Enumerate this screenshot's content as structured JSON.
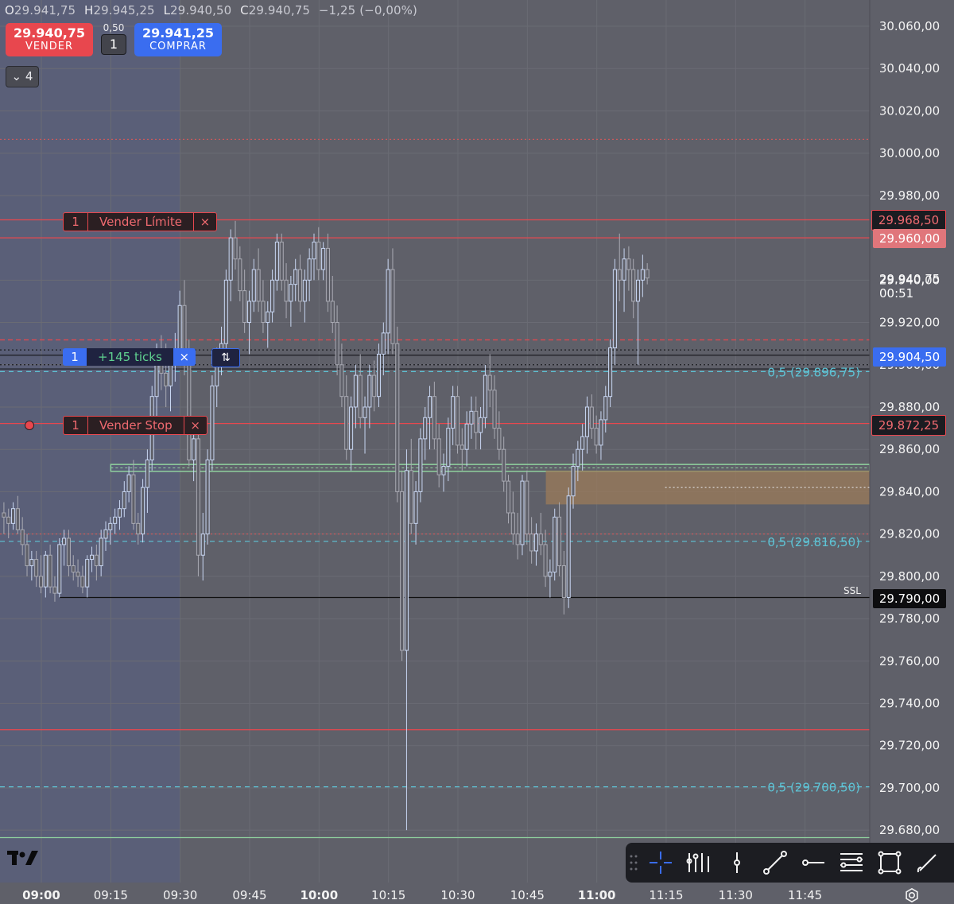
{
  "header": {
    "ohlc": [
      {
        "key": "O",
        "value": "29.941,75"
      },
      {
        "key": "H",
        "value": "29.945,25"
      },
      {
        "key": "L",
        "value": "29.940,50"
      },
      {
        "key": "C",
        "value": "29.940,75"
      }
    ],
    "change": "−1,25 (−0,00%)"
  },
  "trade_panel": {
    "sell_price": "29.940,75",
    "sell_label": "VENDER",
    "spread": "0,50",
    "quantity": "1",
    "buy_price": "29.941,25",
    "buy_label": "COMPRAR"
  },
  "collapse": {
    "label": "4"
  },
  "orders": {
    "limit": {
      "qty": "1",
      "label": "Vender Límite",
      "close": "×"
    },
    "stop": {
      "qty": "1",
      "label": "Vender Stop",
      "close": "×"
    },
    "position": {
      "qty": "1",
      "label": "+145 ticks",
      "close": "×",
      "reverse": "⇅"
    }
  },
  "annotations": {
    "ssl": "SSL",
    "fib_a": "0,5 (29.896,75)",
    "fib_b": "0,5 (29.816,50)",
    "fib_c": "0,5 (29.700,50)"
  },
  "axis_tags": {
    "limit": "29.968,50",
    "alert": "29.960,00",
    "current": "29.940,75",
    "countdown": "00:51",
    "position": "29.904,50",
    "stop": "29.872,25",
    "ssl": "29.790,00"
  },
  "colors": {
    "background": "#5f6069",
    "premarket": "#5a5f79",
    "candle_up": "#c8d6f2",
    "candle_down": "#a9aab3",
    "sell": "#e8474e",
    "buy": "#3a6df0",
    "fib": "#5ec4d6",
    "zone_green": "#8fd19e",
    "zone_brown": "#9b7b5a"
  },
  "toolbar": {
    "icons": [
      "crosshair-icon",
      "fib-tools-icon",
      "vertical-line-icon",
      "trend-line-icon",
      "horizontal-ray-icon",
      "fib-retracement-icon",
      "rectangle-icon",
      "brush-icon"
    ]
  },
  "chart_data": {
    "type": "candlestick",
    "title": "",
    "xlabel": "",
    "ylabel": "",
    "y_ticks": [
      "30.060,00",
      "30.040,00",
      "30.020,00",
      "30.000,00",
      "29.980,00",
      "29.960,00",
      "29.940,00",
      "29.920,00",
      "29.900,00",
      "29.880,00",
      "29.860,00",
      "29.840,00",
      "29.820,00",
      "29.800,00",
      "29.780,00",
      "29.760,00",
      "29.740,00",
      "29.720,00",
      "29.700,00",
      "29.680,00"
    ],
    "y_tick_values": [
      30060,
      30040,
      30020,
      30000,
      29980,
      29960,
      29940,
      29920,
      29900,
      29880,
      29860,
      29840,
      29820,
      29800,
      29780,
      29760,
      29740,
      29720,
      29700,
      29680
    ],
    "x_ticks": [
      "09:00",
      "09:15",
      "09:30",
      "09:45",
      "10:00",
      "10:15",
      "10:30",
      "10:45",
      "11:00",
      "11:15",
      "11:30",
      "11:45"
    ],
    "x_bold_ticks": [
      "09:00",
      "10:00",
      "11:00"
    ],
    "ylim": [
      29670,
      30068
    ],
    "bar_minutes": 1,
    "session_start": "09:00",
    "premarket_end": "09:30",
    "levels": [
      {
        "name": "sell-limit-line",
        "price": 29968.5,
        "color": "#e8474e",
        "style": "solid"
      },
      {
        "name": "alert-line",
        "price": 29960.0,
        "color": "#e8474e",
        "style": "solid"
      },
      {
        "name": "dotted-red-upper",
        "price": 30006.5,
        "color": "#c9595c",
        "style": "dotted"
      },
      {
        "name": "position-line",
        "price": 29904.5,
        "color": "#1b1c21",
        "style": "solid"
      },
      {
        "name": "dashed-red-position",
        "price": 29911.75,
        "color": "#e8474e",
        "style": "dashed"
      },
      {
        "name": "dotted-black-a",
        "price": 29907.0,
        "color": "#1b1c21",
        "style": "dotted"
      },
      {
        "name": "dotted-black-b",
        "price": 29900.0,
        "color": "#1b1c21",
        "style": "dotted"
      },
      {
        "name": "black-line-lower",
        "price": 29898.0,
        "color": "#1b1c21",
        "style": "solid"
      },
      {
        "name": "sell-stop-line",
        "price": 29872.25,
        "color": "#e8474e",
        "style": "solid"
      },
      {
        "name": "dotted-red-lower",
        "price": 29820.0,
        "color": "#c9595c",
        "style": "dotted"
      },
      {
        "name": "red-line-low",
        "price": 29727.5,
        "color": "#e8474e",
        "style": "solid"
      },
      {
        "name": "ssl-line",
        "price": 29790.0,
        "color": "#111111",
        "style": "solid"
      },
      {
        "name": "green-line-bottom",
        "price": 29676.5,
        "color": "#8fd19e",
        "style": "solid"
      }
    ],
    "fib_levels": [
      {
        "price": 29896.75,
        "label_key": "fib_a"
      },
      {
        "price": 29816.5,
        "label_key": "fib_b"
      },
      {
        "price": 29700.5,
        "label_key": "fib_c"
      }
    ],
    "zones": [
      {
        "name": "green-zone",
        "from_time": "09:15",
        "to_time": "end",
        "low": 29850.0,
        "high": 29852.5,
        "color": "#8fd19e"
      },
      {
        "name": "brown-zone",
        "from_time": "10:49",
        "to_time": "end",
        "low": 29834.0,
        "high": 29850.0,
        "color": "#9b7b5a"
      }
    ],
    "candles": [
      [
        29830,
        29835,
        29820,
        29828
      ],
      [
        29828,
        29832,
        29818,
        29825
      ],
      [
        29825,
        29835,
        29822,
        29832
      ],
      [
        29832,
        29838,
        29820,
        29822
      ],
      [
        29822,
        29828,
        29810,
        29815
      ],
      [
        29815,
        29820,
        29800,
        29805
      ],
      [
        29805,
        29812,
        29798,
        29808
      ],
      [
        29808,
        29812,
        29795,
        29800
      ],
      [
        29800,
        29810,
        29792,
        29795
      ],
      [
        29795,
        29812,
        29790,
        29810
      ],
      [
        29810,
        29815,
        29792,
        29795
      ],
      [
        29795,
        29800,
        29788,
        29792
      ],
      [
        29792,
        29818,
        29790,
        29815
      ],
      [
        29815,
        29822,
        29805,
        29818
      ],
      [
        29818,
        29822,
        29800,
        29805
      ],
      [
        29805,
        29810,
        29798,
        29802
      ],
      [
        29802,
        29808,
        29795,
        29800
      ],
      [
        29800,
        29805,
        29792,
        29795
      ],
      [
        29795,
        29810,
        29790,
        29808
      ],
      [
        29808,
        29814,
        29802,
        29810
      ],
      [
        29810,
        29815,
        29798,
        29805
      ],
      [
        29805,
        29822,
        29800,
        29818
      ],
      [
        29818,
        29826,
        29812,
        29822
      ],
      [
        29822,
        29828,
        29815,
        29825
      ],
      [
        29825,
        29832,
        29820,
        29828
      ],
      [
        29828,
        29836,
        29822,
        29832
      ],
      [
        29832,
        29845,
        29828,
        29840
      ],
      [
        29840,
        29852,
        29835,
        29848
      ],
      [
        29848,
        29855,
        29822,
        29825
      ],
      [
        29825,
        29830,
        29815,
        29820
      ],
      [
        29820,
        29846,
        29816,
        29842
      ],
      [
        29842,
        29860,
        29830,
        29855
      ],
      [
        29855,
        29890,
        29850,
        29885
      ],
      [
        29885,
        29910,
        29875,
        29900
      ],
      [
        29900,
        29914,
        29888,
        29896
      ],
      [
        29896,
        29910,
        29880,
        29890
      ],
      [
        29890,
        29905,
        29878,
        29900
      ],
      [
        29900,
        29915,
        29892,
        29905
      ],
      [
        29905,
        29935,
        29900,
        29928
      ],
      [
        29928,
        29940,
        29895,
        29900
      ],
      [
        29900,
        29912,
        29852,
        29855
      ],
      [
        29855,
        29870,
        29845,
        29865
      ],
      [
        29865,
        29870,
        29800,
        29810
      ],
      [
        29810,
        29830,
        29798,
        29820
      ],
      [
        29820,
        29860,
        29815,
        29855
      ],
      [
        29855,
        29895,
        29850,
        29890
      ],
      [
        29890,
        29908,
        29880,
        29905
      ],
      [
        29905,
        29918,
        29895,
        29910
      ],
      [
        29910,
        29945,
        29905,
        29940
      ],
      [
        29940,
        29964,
        29930,
        29960
      ],
      [
        29960,
        29968,
        29945,
        29950
      ],
      [
        29950,
        29956,
        29930,
        29935
      ],
      [
        29935,
        29945,
        29915,
        29920
      ],
      [
        29920,
        29935,
        29905,
        29930
      ],
      [
        29930,
        29950,
        29925,
        29945
      ],
      [
        29945,
        29955,
        29925,
        29930
      ],
      [
        29930,
        29940,
        29915,
        29920
      ],
      [
        29920,
        29930,
        29908,
        29925
      ],
      [
        29925,
        29945,
        29920,
        29940
      ],
      [
        29940,
        29962,
        29935,
        29958
      ],
      [
        29958,
        29962,
        29935,
        29940
      ],
      [
        29940,
        29948,
        29922,
        29930
      ],
      [
        29930,
        29942,
        29918,
        29938
      ],
      [
        29938,
        29950,
        29930,
        29945
      ],
      [
        29945,
        29952,
        29925,
        29930
      ],
      [
        29930,
        29945,
        29920,
        29940
      ],
      [
        29940,
        29955,
        29930,
        29950
      ],
      [
        29950,
        29962,
        29940,
        29958
      ],
      [
        29958,
        29965,
        29940,
        29945
      ],
      [
        29945,
        29958,
        29940,
        29955
      ],
      [
        29955,
        29962,
        29925,
        29930
      ],
      [
        29930,
        29942,
        29915,
        29920
      ],
      [
        29920,
        29928,
        29895,
        29900
      ],
      [
        29900,
        29910,
        29880,
        29885
      ],
      [
        29885,
        29895,
        29855,
        29860
      ],
      [
        29860,
        29885,
        29850,
        29880
      ],
      [
        29880,
        29900,
        29870,
        29895
      ],
      [
        29895,
        29905,
        29870,
        29875
      ],
      [
        29875,
        29885,
        29858,
        29880
      ],
      [
        29880,
        29900,
        29870,
        29895
      ],
      [
        29895,
        29902,
        29878,
        29885
      ],
      [
        29885,
        29910,
        29880,
        29905
      ],
      [
        29905,
        29920,
        29895,
        29915
      ],
      [
        29915,
        29950,
        29905,
        29945
      ],
      [
        29945,
        29955,
        29905,
        29910
      ],
      [
        29910,
        29918,
        29835,
        29840
      ],
      [
        29840,
        29850,
        29760,
        29765
      ],
      [
        29765,
        29860,
        29680,
        29850
      ],
      [
        29850,
        29865,
        29820,
        29825
      ],
      [
        29825,
        29845,
        29815,
        29840
      ],
      [
        29840,
        29870,
        29835,
        29865
      ],
      [
        29865,
        29880,
        29855,
        29875
      ],
      [
        29875,
        29890,
        29860,
        29885
      ],
      [
        29885,
        29892,
        29860,
        29865
      ],
      [
        29865,
        29872,
        29842,
        29848
      ],
      [
        29848,
        29858,
        29840,
        29852
      ],
      [
        29852,
        29875,
        29845,
        29870
      ],
      [
        29870,
        29890,
        29862,
        29885
      ],
      [
        29885,
        29890,
        29858,
        29862
      ],
      [
        29862,
        29870,
        29850,
        29860
      ],
      [
        29860,
        29878,
        29852,
        29872
      ],
      [
        29872,
        29885,
        29865,
        29878
      ],
      [
        29878,
        29885,
        29860,
        29868
      ],
      [
        29868,
        29880,
        29860,
        29875
      ],
      [
        29875,
        29900,
        29870,
        29895
      ],
      [
        29895,
        29905,
        29880,
        29888
      ],
      [
        29888,
        29895,
        29865,
        29870
      ],
      [
        29870,
        29878,
        29855,
        29860
      ],
      [
        29860,
        29866,
        29840,
        29845
      ],
      [
        29845,
        29848,
        29825,
        29830
      ],
      [
        29830,
        29840,
        29815,
        29820
      ],
      [
        29820,
        29830,
        29808,
        29815
      ],
      [
        29815,
        29848,
        29810,
        29845
      ],
      [
        29845,
        29850,
        29815,
        29820
      ],
      [
        29820,
        29828,
        29806,
        29812
      ],
      [
        29812,
        29825,
        29805,
        29820
      ],
      [
        29820,
        29830,
        29810,
        29815
      ],
      [
        29815,
        29822,
        29795,
        29800
      ],
      [
        29800,
        29808,
        29790,
        29802
      ],
      [
        29802,
        29832,
        29798,
        29828
      ],
      [
        29828,
        29835,
        29800,
        29805
      ],
      [
        29805,
        29812,
        29782,
        29790
      ],
      [
        29790,
        29842,
        29785,
        29838
      ],
      [
        29838,
        29858,
        29832,
        29852
      ],
      [
        29852,
        29864,
        29845,
        29860
      ],
      [
        29860,
        29872,
        29850,
        29866
      ],
      [
        29866,
        29885,
        29858,
        29880
      ],
      [
        29880,
        29886,
        29865,
        29870
      ],
      [
        29870,
        29876,
        29858,
        29862
      ],
      [
        29862,
        29878,
        29855,
        29874
      ],
      [
        29874,
        29890,
        29868,
        29885
      ],
      [
        29885,
        29912,
        29880,
        29908
      ],
      [
        29908,
        29950,
        29900,
        29945
      ],
      [
        29945,
        29962,
        29930,
        29940
      ],
      [
        29940,
        29955,
        29925,
        29950
      ],
      [
        29950,
        29956,
        29935,
        29945
      ],
      [
        29945,
        29950,
        29922,
        29930
      ],
      [
        29930,
        29945,
        29900,
        29940
      ],
      [
        29940,
        29952,
        29932,
        29945
      ],
      [
        29945,
        29948,
        29938,
        29941
      ]
    ]
  }
}
